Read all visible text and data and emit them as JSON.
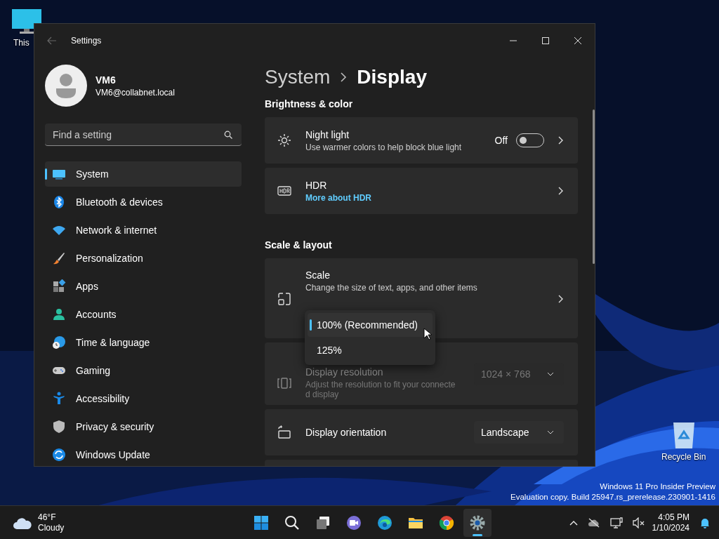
{
  "desktop": {
    "icons": [
      {
        "label": "This"
      },
      {
        "label": "Recycle Bin"
      }
    ],
    "watermark": [
      "Windows 11 Pro Insider Preview",
      "Evaluation copy. Build 25947.rs_prerelease.230901-1416"
    ]
  },
  "window": {
    "title": "Settings",
    "user": {
      "name": "VM6",
      "email": "VM6@collabnet.local"
    },
    "search": {
      "placeholder": "Find a setting"
    },
    "nav": [
      {
        "label": "System",
        "selected": true
      },
      {
        "label": "Bluetooth & devices",
        "selected": false
      },
      {
        "label": "Network & internet",
        "selected": false
      },
      {
        "label": "Personalization",
        "selected": false
      },
      {
        "label": "Apps",
        "selected": false
      },
      {
        "label": "Accounts",
        "selected": false
      },
      {
        "label": "Time & language",
        "selected": false
      },
      {
        "label": "Gaming",
        "selected": false
      },
      {
        "label": "Accessibility",
        "selected": false
      },
      {
        "label": "Privacy & security",
        "selected": false
      },
      {
        "label": "Windows Update",
        "selected": false
      }
    ],
    "breadcrumb": [
      "System",
      "Display"
    ],
    "sections": [
      {
        "title": "Brightness & color",
        "cards": [
          {
            "kind": "toggle",
            "title": "Night light",
            "subtitle": "Use warmer colors to help block blue light",
            "value": "Off",
            "on": false
          },
          {
            "kind": "link",
            "title": "HDR",
            "link": "More about HDR"
          }
        ]
      },
      {
        "title": "Scale & layout",
        "cards": [
          {
            "kind": "nav",
            "title": "Scale",
            "subtitle": "Change the size of text, apps, and other items"
          },
          {
            "kind": "select",
            "title": "Display resolution",
            "subtitle": "Adjust the resolution to fit your connected display",
            "value": "1024 × 768",
            "disabled": true
          },
          {
            "kind": "select",
            "title": "Display orientation",
            "value": "Landscape",
            "disabled": false
          }
        ]
      }
    ],
    "scale_menu": [
      {
        "label": "100% (Recommended)",
        "selected": true
      },
      {
        "label": "125%",
        "selected": false
      }
    ]
  },
  "taskbar": {
    "weather": {
      "temperature": "46°F",
      "condition": "Cloudy"
    },
    "apps": [
      {
        "selected": false
      },
      {
        "selected": false
      },
      {
        "selected": false
      },
      {
        "selected": false
      },
      {
        "selected": false
      },
      {
        "selected": false
      },
      {
        "selected": false
      },
      {
        "selected": true
      }
    ],
    "clock": {
      "time": "4:05 PM",
      "date": "1/10/2024"
    }
  }
}
